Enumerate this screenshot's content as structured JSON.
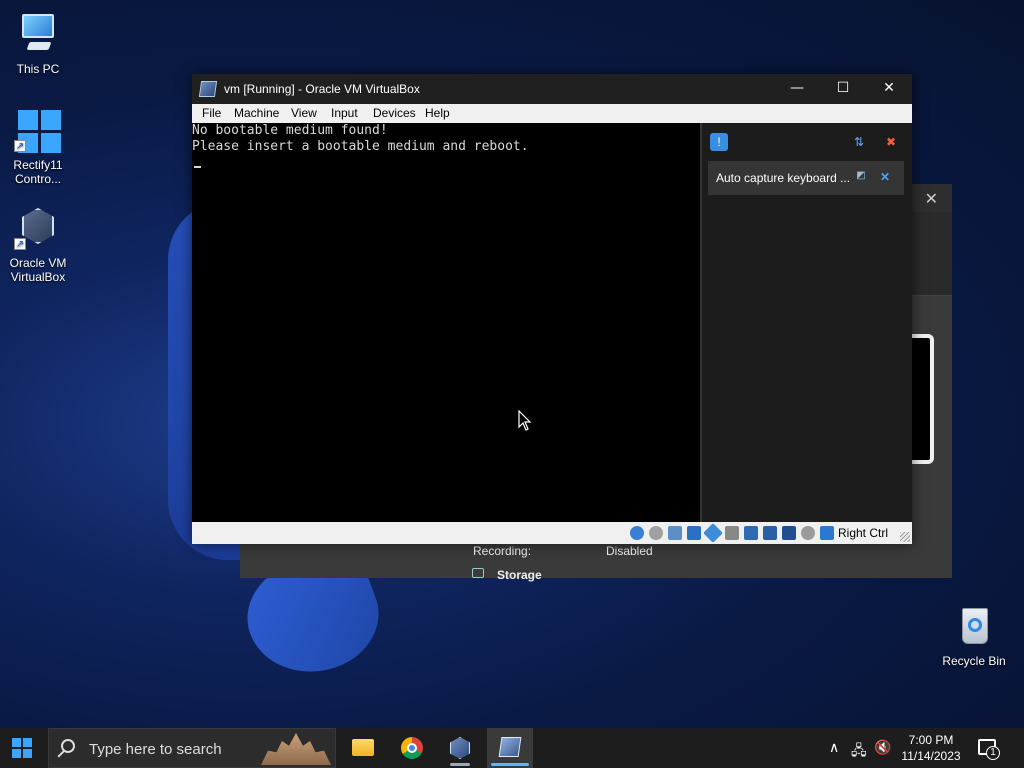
{
  "desktop": {
    "icons": [
      {
        "label": "This PC",
        "icon": "computer-icon"
      },
      {
        "label": "Rectify11\nContro...",
        "icon": "windows-control-panel-icon"
      },
      {
        "label": "Oracle VM\nVirtualBox",
        "icon": "virtualbox-icon"
      },
      {
        "label": "Recycle Bin",
        "icon": "recycle-bin-icon"
      }
    ]
  },
  "background_window": {
    "recording_label": "Recording:",
    "recording_value": "Disabled",
    "storage_label": "Storage"
  },
  "vm_window": {
    "title": "vm [Running] - Oracle VM VirtualBox",
    "controls": {
      "minimize": "—",
      "maximize": "☐",
      "close": "✕"
    },
    "menu": [
      "File",
      "Machine",
      "View",
      "Input",
      "Devices",
      "Help"
    ],
    "console_lines": [
      "No bootable medium found!",
      "Please insert a bootable medium and reboot."
    ],
    "notification": {
      "message": "Auto capture keyboard ...",
      "icons": [
        "notification-center-icon",
        "sort-icon",
        "clear-all-icon",
        "pin-icon",
        "close-icon"
      ]
    },
    "status": {
      "host_key": "Right Ctrl",
      "icons": [
        "hard-disk-icon",
        "optical-drive-icon",
        "audio-icon",
        "network-icon",
        "usb-icon",
        "shared-folders-icon",
        "display-icon",
        "recording-icon",
        "vt-x-icon",
        "mouse-integration-icon",
        "keyboard-capture-icon"
      ]
    }
  },
  "taskbar": {
    "search_placeholder": "Type here to search",
    "apps": [
      "file-explorer-icon",
      "chrome-icon",
      "virtualbox-manager-icon",
      "virtualbox-vm-icon"
    ],
    "time": "7:00 PM",
    "date": "11/14/2023",
    "notification_count": "1",
    "colors": {
      "accent": "#3aa6ff",
      "taskbar": "#1d1d1d"
    }
  }
}
